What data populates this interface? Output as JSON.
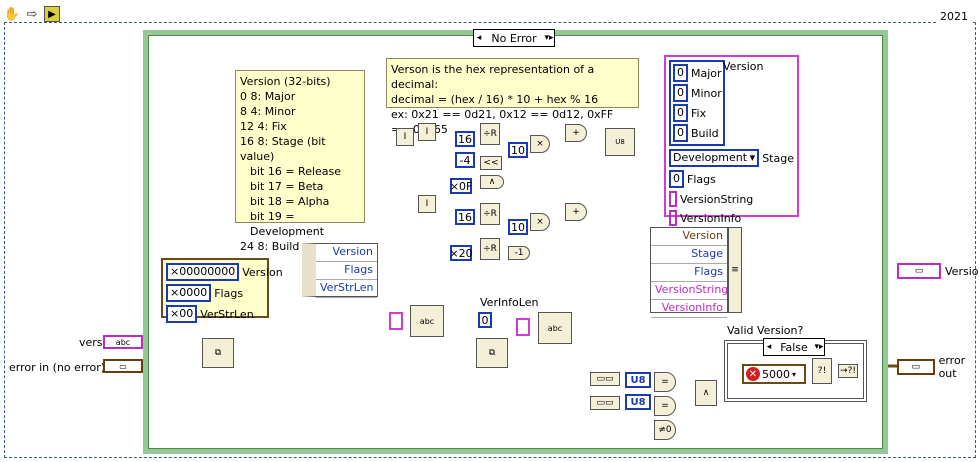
{
  "toolbar": {
    "icons": [
      "hand-icon",
      "arrow-icon",
      "run-icon"
    ]
  },
  "version_label": "2021",
  "case_structure": {
    "selector": "No Error",
    "inner_case": {
      "label": "Valid Version?",
      "selector": "False"
    }
  },
  "notes": {
    "bitfield": [
      "Version (32-bits)",
      "0 8: Major",
      "8 4: Minor",
      "12 4: Fix",
      "16 8: Stage (bit value)",
      "   bit 16 = Release",
      "   bit 17 = Beta",
      "   bit 18 = Alpha",
      "   bit 19 = Development",
      "24 8: Build"
    ],
    "hex": [
      "Verson is the hex representation of a decimal:",
      "decimal = (hex / 16) * 10 + hex % 16",
      "ex: 0x21 == 0d21, 0x12 == 0d12, 0xFF == 0d165"
    ]
  },
  "input_cluster": {
    "rows": [
      {
        "value": "×00000000",
        "label": "Version"
      },
      {
        "value": "×0000",
        "label": "Flags"
      },
      {
        "value": "×00",
        "label": "VerStrLen"
      }
    ]
  },
  "unbundle": {
    "items": [
      "Version",
      "Flags",
      "VerStrLen"
    ]
  },
  "output_cluster": {
    "title": "Version",
    "rows": [
      {
        "value": "0",
        "label": "Major"
      },
      {
        "value": "0",
        "label": "Minor"
      },
      {
        "value": "0",
        "label": "Fix"
      },
      {
        "value": "0",
        "label": "Build"
      }
    ],
    "stage_value": "Development",
    "stage_label": "Stage",
    "flags_value": "0",
    "flags_label": "Flags",
    "string_labels": [
      "VersionString",
      "VersionInfo"
    ]
  },
  "bundle": {
    "items": [
      "Version",
      "Stage",
      "Flags",
      "VersionString",
      "VersionInfo"
    ]
  },
  "constants": {
    "c16a": "16",
    "c4": "-4",
    "c10a": "10",
    "c0F": "×0F",
    "c16b": "16",
    "c10b": "10",
    "c20": "×20",
    "c0": "0",
    "c5000": "5000"
  },
  "labels": {
    "verinfolen": "VerInfoLen",
    "u8": "U8",
    "neq0": "≠0"
  },
  "terminals": {
    "vers": "vers",
    "error_in": "error in (no error)",
    "version_out": "Version",
    "error_out": "error out"
  }
}
